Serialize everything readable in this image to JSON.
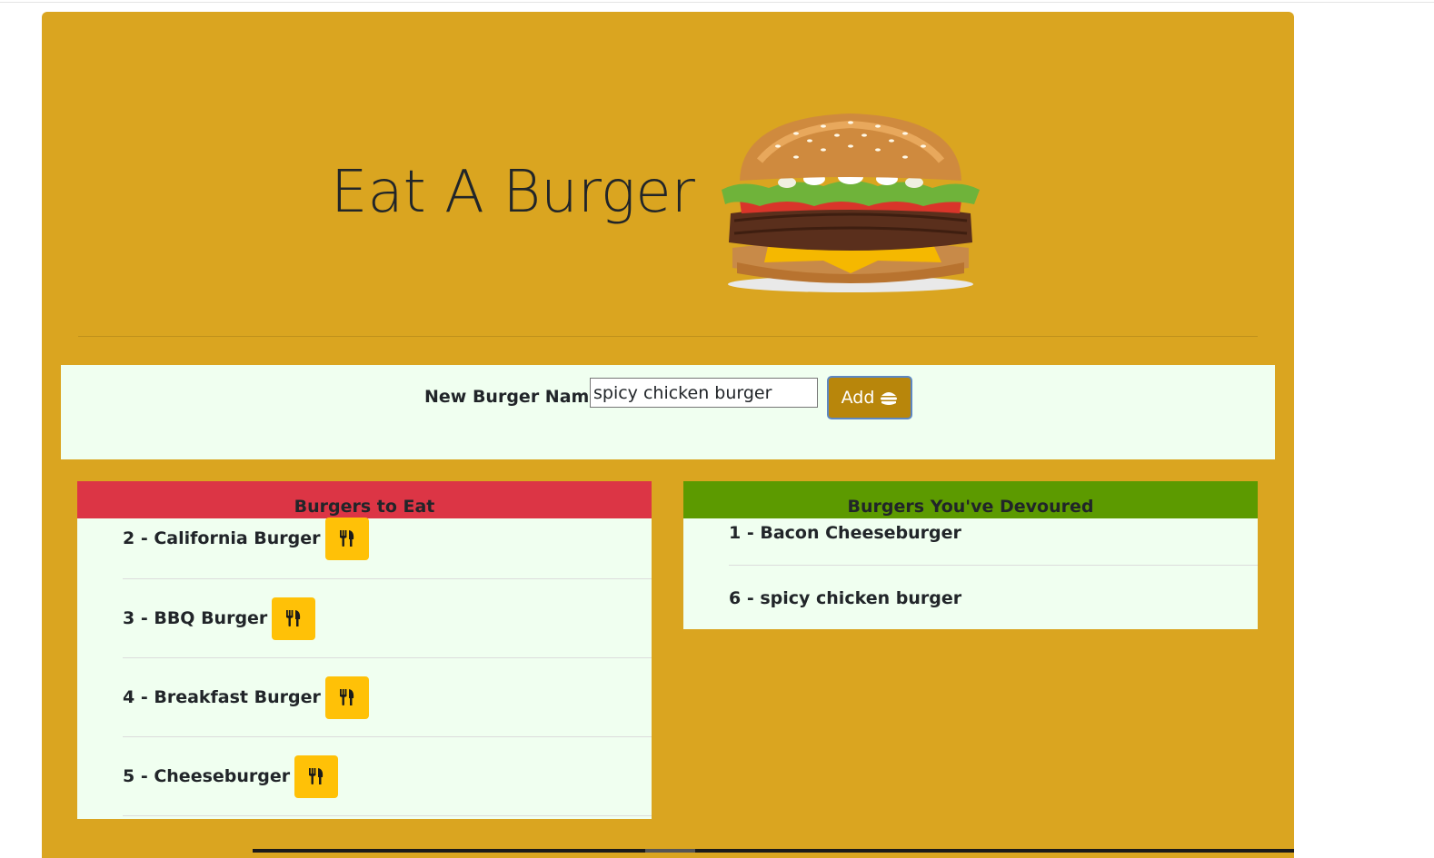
{
  "header": {
    "title": "Eat A Burger"
  },
  "form": {
    "label": "New Burger Name:",
    "input_value": "spicy chicken burger",
    "add_label": "Add"
  },
  "to_eat": {
    "heading": "Burgers to Eat",
    "items": [
      {
        "label": "2 - California Burger"
      },
      {
        "label": "3 - BBQ Burger"
      },
      {
        "label": "4 - Breakfast Burger"
      },
      {
        "label": "5 - Cheeseburger"
      }
    ]
  },
  "devoured": {
    "heading": "Burgers You've Devoured",
    "items": [
      {
        "label": "1 - Bacon Cheeseburger"
      },
      {
        "label": "6 - spicy chicken burger"
      }
    ]
  },
  "icons": {
    "eat_button": "utensils-icon",
    "add_button": "hamburger-icon"
  },
  "colors": {
    "page_background": "#daa520",
    "panel_background": "#f0fff0",
    "to_eat_header": "#dc3545",
    "devoured_header": "#5c9a00",
    "eat_button": "#ffc107",
    "add_button": "#b8860b"
  }
}
